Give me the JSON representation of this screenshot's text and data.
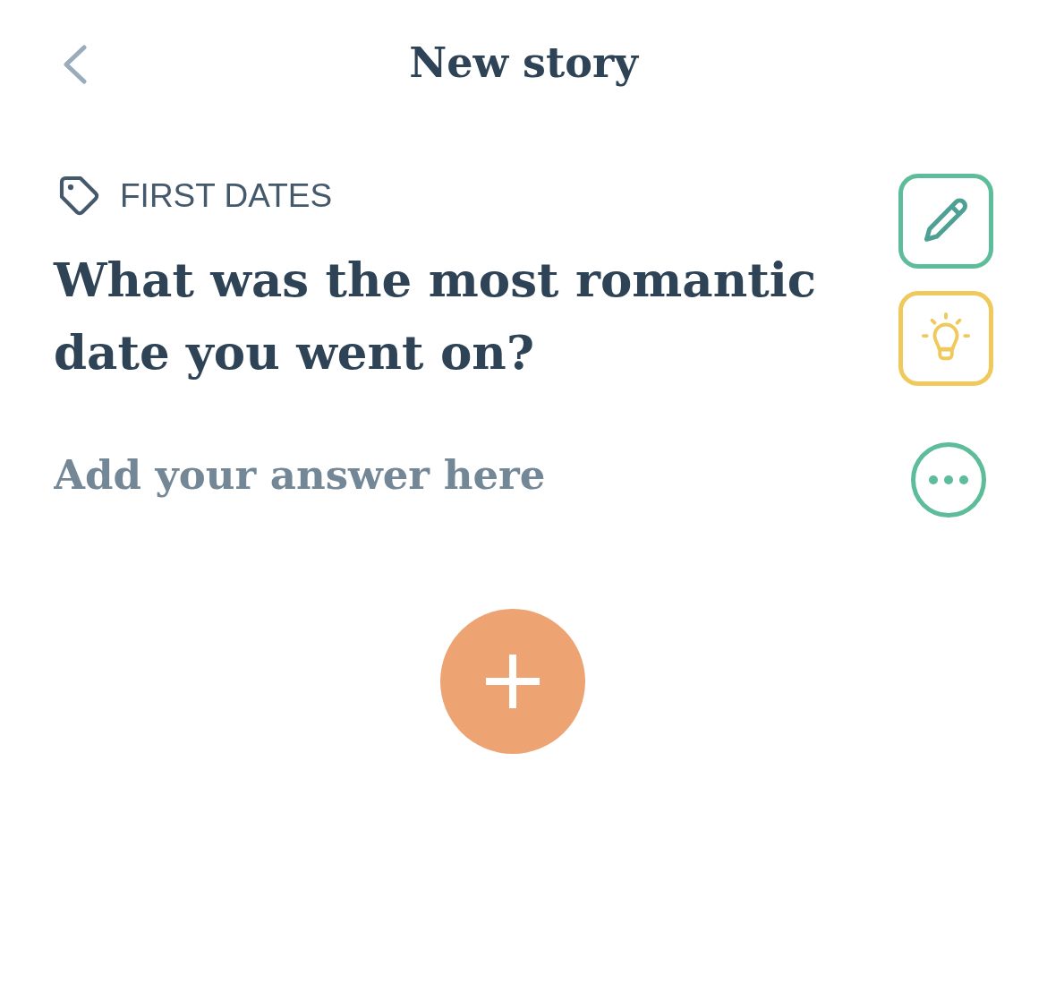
{
  "header": {
    "title": "New story"
  },
  "prompt": {
    "category": "FIRST DATES",
    "question": "What was the most romantic date you went on?"
  },
  "answer": {
    "placeholder": "Add your answer here"
  }
}
